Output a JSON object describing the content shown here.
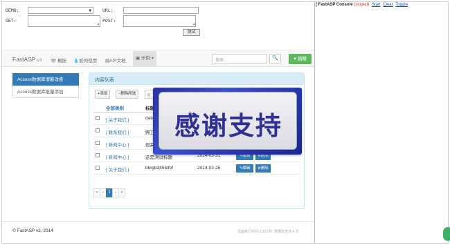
{
  "debug": {
    "demo_label": "DEMO:",
    "url_label": "URL:",
    "get_label": "GET:",
    "post_label": "POST:",
    "test_button": "测试"
  },
  "console": {
    "title": "[ FastASP Console",
    "status": "(stoped)",
    "start": "Start",
    "clear": "Clear",
    "toggle": "Toggle"
  },
  "navbar": {
    "brand": "FastASP",
    "version": "v3",
    "links": [
      "概括",
      "如何使用",
      "API文档",
      "示例"
    ],
    "search_placeholder": "搜索...",
    "donate": "捐赠"
  },
  "sidebar": {
    "items": [
      "Access数据库增删改查",
      "Access数据库批量添加"
    ]
  },
  "panel": {
    "title": "内容列表",
    "buttons": {
      "add": "添加",
      "delete_selected": "删除所选",
      "search_placeholder": "搜"
    },
    "columns": {
      "category": "全部类别",
      "title": "标题"
    },
    "rows": [
      {
        "category": "[ 关于我们 ]",
        "title": "date",
        "date": "",
        "edit": "",
        "del": ""
      },
      {
        "category": "[ 联系我们 ]",
        "title": "腾工",
        "date": "",
        "edit": "",
        "del": ""
      },
      {
        "category": "[ 新闻中心 ]",
        "title": "很呆",
        "date": "",
        "edit": "",
        "del": ""
      },
      {
        "category": "[ 新闻中心 ]",
        "title": "这是测试标题",
        "date": "2014-03-31",
        "edit": "编辑",
        "del": "删除"
      },
      {
        "category": "[ 关于我们 ]",
        "title": "bbrgb345fefef",
        "date": "2014-03-25",
        "edit": "编辑",
        "del": "删除"
      }
    ],
    "pager": [
      "«",
      "‹",
      "1",
      "›",
      "»"
    ]
  },
  "overlay": {
    "text": "感谢支持"
  },
  "footer": {
    "copyright": "© FastASP v3, 2014",
    "stats": "页面执行时间 0.203 秒, 数据库查询 4 次"
  }
}
